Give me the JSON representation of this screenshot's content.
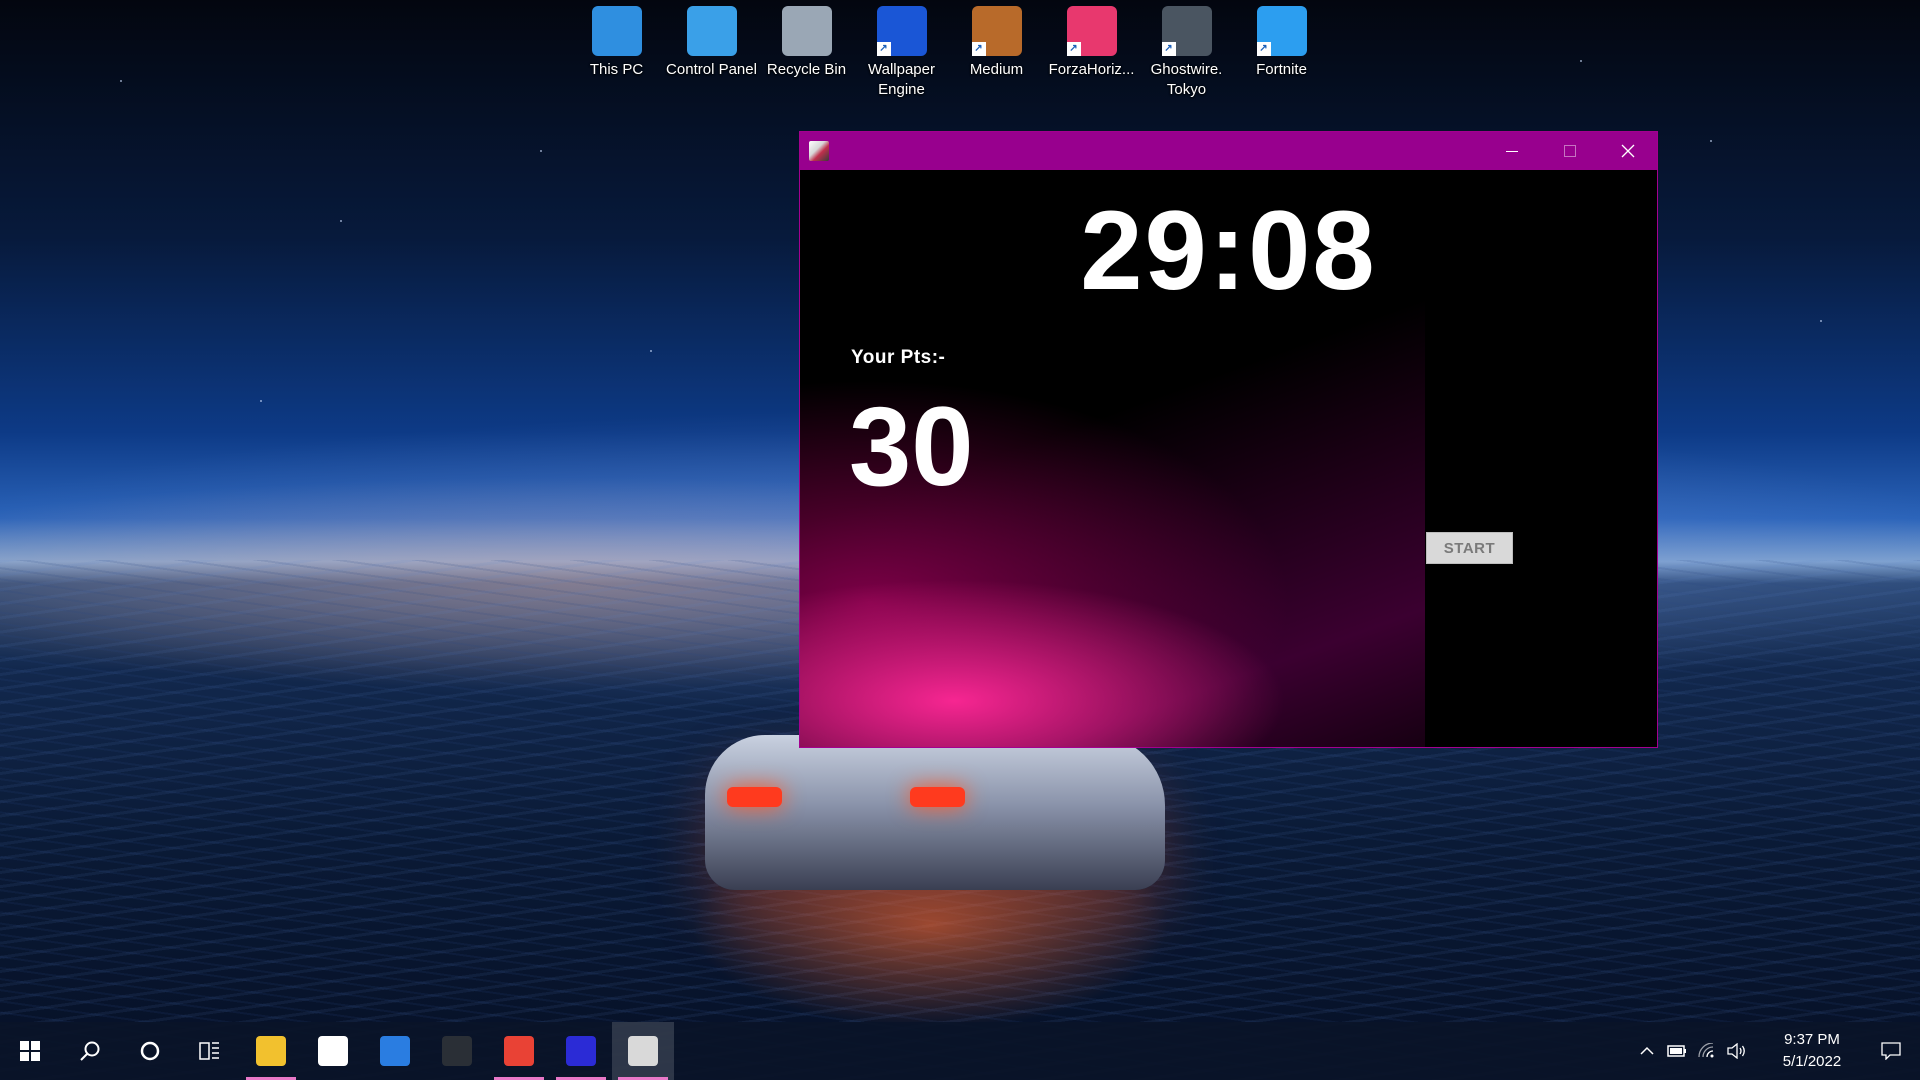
{
  "desktop": {
    "icons": [
      {
        "label": "This PC",
        "icon": "computer-icon",
        "color": "#2f8fe0",
        "shortcut": false
      },
      {
        "label": "Control Panel",
        "icon": "control-panel-icon",
        "color": "#3aa0e8",
        "shortcut": false
      },
      {
        "label": "Recycle Bin",
        "icon": "recycle-bin-icon",
        "color": "#9aa7b5",
        "shortcut": false
      },
      {
        "label": "Wallpaper Engine",
        "icon": "wallpaper-engine-icon",
        "color": "#1a56d6",
        "shortcut": true
      },
      {
        "label": "Medium",
        "icon": "medium-icon",
        "color": "#b86a2a",
        "shortcut": true
      },
      {
        "label": "ForzaHoriz...",
        "icon": "forza-icon",
        "color": "#e8386e",
        "shortcut": true
      },
      {
        "label": "Ghostwire. Tokyo",
        "icon": "ghostwire-icon",
        "color": "#4a5561",
        "shortcut": true
      },
      {
        "label": "Fortnite",
        "icon": "fortnite-icon",
        "color": "#2c9ef0",
        "shortcut": true
      }
    ]
  },
  "app_window": {
    "titlebar_color": "#98008e",
    "timer": "29:08",
    "points_label": "Your Pts:-",
    "points_value": "30",
    "start_label": "START"
  },
  "taskbar": {
    "apps": [
      {
        "name": "file-explorer",
        "color": "#f2c12e",
        "running": true,
        "active": false
      },
      {
        "name": "microsoft-store",
        "color": "#ffffff",
        "running": false,
        "active": false
      },
      {
        "name": "mail",
        "color": "#2a7de1",
        "running": false,
        "active": false
      },
      {
        "name": "predator-sense",
        "color": "#2a2f36",
        "running": false,
        "active": false
      },
      {
        "name": "chrome",
        "color": "#e94235",
        "running": true,
        "active": false
      },
      {
        "name": "intellij",
        "color": "#2b2bd6",
        "running": true,
        "active": false
      },
      {
        "name": "java-game",
        "color": "#d9d9d9",
        "running": true,
        "active": true
      }
    ],
    "clock": {
      "time": "9:37 PM",
      "date": "5/1/2022"
    }
  }
}
